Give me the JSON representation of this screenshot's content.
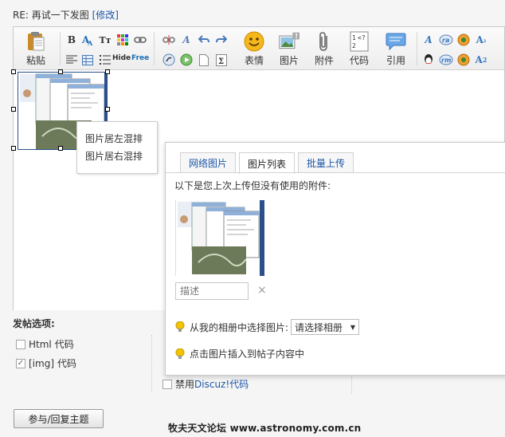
{
  "title": {
    "text": "RE: 再试一下发图",
    "edit_link": "[修改]"
  },
  "toolbar": {
    "paste": "粘贴",
    "hide": "Hide",
    "free": "Free",
    "emoji": "表情",
    "image": "图片",
    "attachment": "附件",
    "code": "代码",
    "quote": "引用",
    "image_badge": "!"
  },
  "context_menu": {
    "items": [
      "图片居左混排",
      "图片居右混排"
    ]
  },
  "image_panel": {
    "tabs": [
      "网络图片",
      "图片列表",
      "批量上传"
    ],
    "active_tab": 1,
    "hint": "以下是您上次上传但没有使用的附件:",
    "desc_placeholder": "描述",
    "delete_glyph": "×",
    "album_label": "从我的相册中选择图片:",
    "album_select": "请选择相册",
    "insert_tip": "点击图片插入到帖子内容中"
  },
  "options": {
    "title": "发帖选项:",
    "html_code": "Html 代码",
    "img_code": "[img] 代码",
    "disable_discuz_prefix": "禁用 ",
    "disable_discuz_link": "Discuz!代码",
    "img_checked_glyph": "✓"
  },
  "submit_button": "参与/回复主题",
  "watermark": "牧夫天文论坛 www.astronomy.com.cn",
  "colors": {
    "link": "#1d56a8",
    "accent_blue": "#2a4f8a",
    "bulb": "#f2c300"
  }
}
